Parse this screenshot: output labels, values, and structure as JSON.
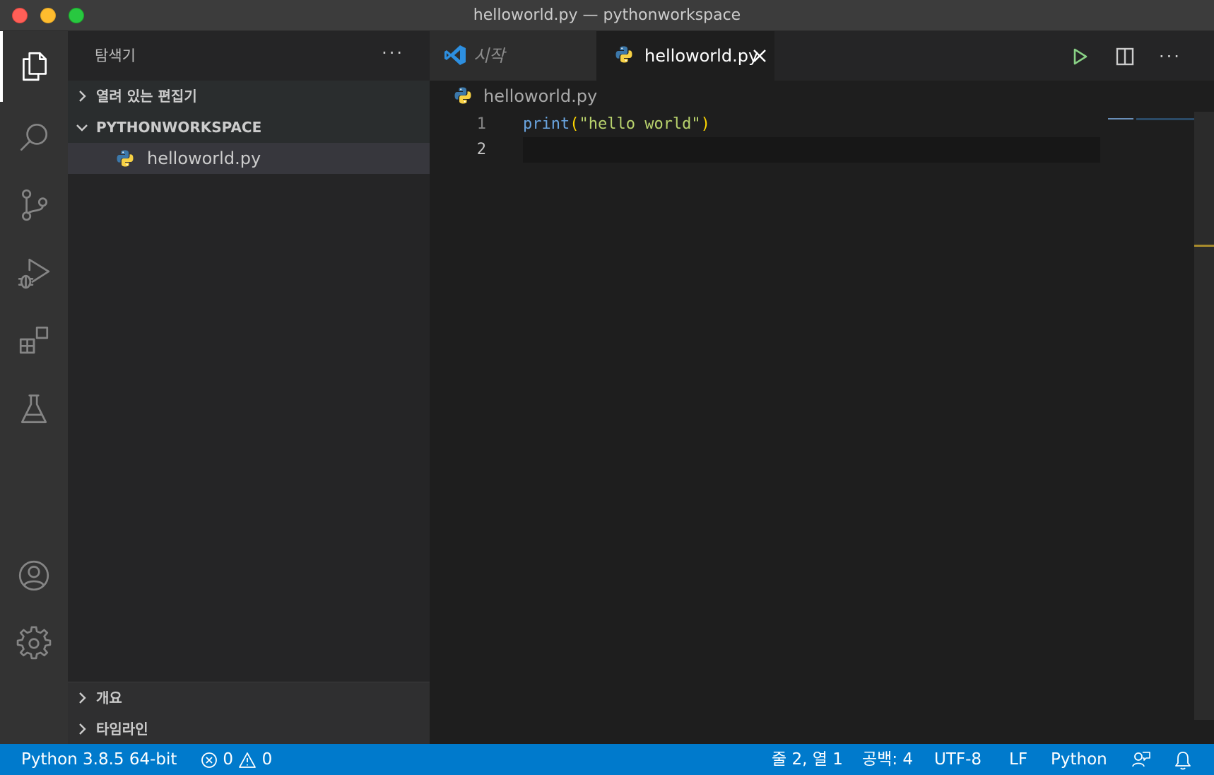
{
  "window": {
    "title": "helloworld.py — pythonworkspace"
  },
  "activity_bar": {
    "items": [
      {
        "icon": "explorer-icon",
        "active": true
      },
      {
        "icon": "search-icon",
        "active": false
      },
      {
        "icon": "source-control-icon",
        "active": false
      },
      {
        "icon": "run-debug-icon",
        "active": false
      },
      {
        "icon": "extensions-icon",
        "active": false
      },
      {
        "icon": "testing-icon",
        "active": false
      }
    ],
    "bottom_items": [
      {
        "icon": "account-icon"
      },
      {
        "icon": "gear-icon"
      }
    ]
  },
  "sidebar": {
    "title": "탐색기",
    "more_label": "···",
    "sections": {
      "open_editors": "열려 있는 편집기",
      "workspace": "PYTHONWORKSPACE",
      "outline": "개요",
      "timeline": "타임라인"
    },
    "files": [
      {
        "name": "helloworld.py",
        "icon": "python-icon"
      }
    ]
  },
  "editor": {
    "tabs": [
      {
        "label": "시작",
        "icon": "vscode-icon",
        "active": false
      },
      {
        "label": "helloworld.py",
        "icon": "python-icon",
        "active": true
      }
    ],
    "more_label": "···",
    "breadcrumb": "helloworld.py",
    "lines": [
      {
        "number": "1",
        "tokens": {
          "fn": "print",
          "open": "(",
          "str": "\"hello world\"",
          "close": ")"
        }
      },
      {
        "number": "2"
      }
    ]
  },
  "status_bar": {
    "interpreter": "Python 3.8.5 64-bit",
    "errors": "0",
    "warnings": "0",
    "position": "줄 2, 열 1",
    "spaces": "공백: 4",
    "encoding": "UTF-8",
    "eol": "LF",
    "language": "Python"
  },
  "colors": {
    "status_bar": "#007acc",
    "sidebar": "#252526",
    "editor": "#1e1e1e",
    "activity_bar": "#333333"
  }
}
